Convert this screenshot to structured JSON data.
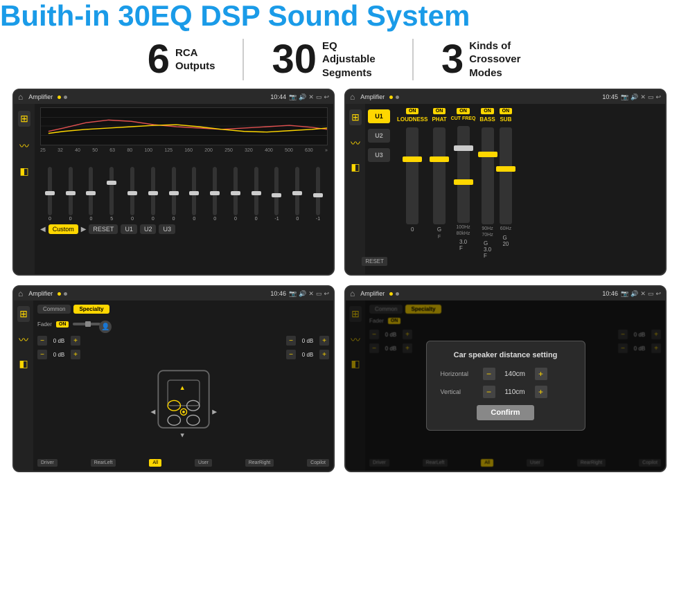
{
  "header": {
    "title": "Buith-in 30EQ DSP Sound System"
  },
  "stats": [
    {
      "number": "6",
      "text": "RCA\nOutputs"
    },
    {
      "number": "30",
      "text": "EQ Adjustable\nSegments"
    },
    {
      "number": "3",
      "text": "Kinds of\nCrossover Modes"
    }
  ],
  "screens": [
    {
      "id": "screen1",
      "statusbar": {
        "title": "Amplifier",
        "time": "10:44"
      },
      "type": "eq"
    },
    {
      "id": "screen2",
      "statusbar": {
        "title": "Amplifier",
        "time": "10:45"
      },
      "type": "crossover"
    },
    {
      "id": "screen3",
      "statusbar": {
        "title": "Amplifier",
        "time": "10:46"
      },
      "type": "speaker"
    },
    {
      "id": "screen4",
      "statusbar": {
        "title": "Amplifier",
        "time": "10:46"
      },
      "type": "distance",
      "dialog": {
        "title": "Car speaker distance setting",
        "horizontal_label": "Horizontal",
        "horizontal_value": "140cm",
        "vertical_label": "Vertical",
        "vertical_value": "110cm",
        "confirm_label": "Confirm"
      }
    }
  ],
  "eq": {
    "frequencies": [
      "25",
      "32",
      "40",
      "50",
      "63",
      "80",
      "100",
      "125",
      "160",
      "200",
      "250",
      "320",
      "400",
      "500",
      "630"
    ],
    "values": [
      "0",
      "0",
      "0",
      "0",
      "5",
      "0",
      "0",
      "0",
      "0",
      "0",
      "0",
      "0",
      "-1",
      "0",
      "-1"
    ],
    "buttons": [
      "Custom",
      "RESET",
      "U1",
      "U2",
      "U3"
    ]
  },
  "crossover": {
    "presets": [
      "U1",
      "U2",
      "U3"
    ],
    "channels": [
      "LOUDNESS",
      "PHAT",
      "CUT FREQ",
      "BASS",
      "SUB"
    ]
  },
  "speaker": {
    "tabs": [
      "Common",
      "Specialty"
    ],
    "fader": "Fader",
    "labels": [
      "Driver",
      "RearLeft",
      "All",
      "User",
      "RearRight",
      "Copilot"
    ],
    "vol_default": "0 dB"
  }
}
